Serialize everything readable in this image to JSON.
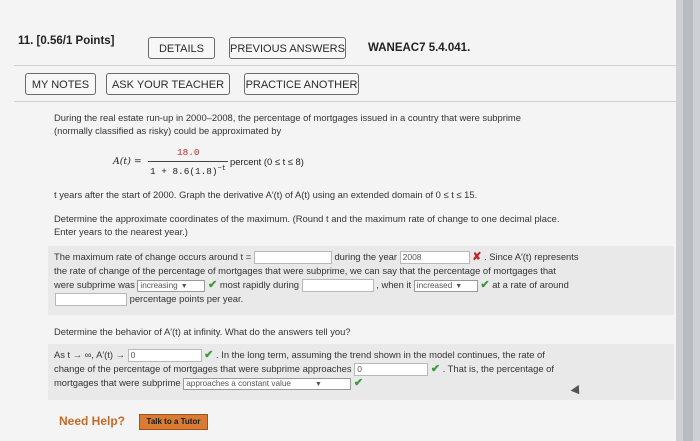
{
  "question": {
    "number_points": "11. [0.56/1 Points]",
    "details": "DETAILS",
    "previous_answers": "PREVIOUS ANSWERS",
    "code": "WANEAC7 5.4.041.",
    "my_notes": "MY NOTES",
    "ask_teacher": "ASK YOUR TEACHER",
    "practice_another": "PRACTICE ANOTHER"
  },
  "text": {
    "intro_1": "During the real estate run-up in 2000–2008, the percentage of mortgages issued in a country that were subprime",
    "intro_2": "(normally classified as risky) could be approximated by",
    "func_name": "A(t) =",
    "numerator": "18.0",
    "denominator": "1 + 8.6(1.8)",
    "exponent": "−t",
    "func_tail": "percent   (0 ≤ t ≤ 8)",
    "line_a": "t years after the start of 2000. Graph the derivative A′(t) of A(t) using an extended domain of 0 ≤ t ≤ 15.",
    "line_b1": "Determine the approximate coordinates of the maximum. (Round t and the maximum rate of change to one decimal place.",
    "line_b2": "Enter years to the nearest year.)",
    "max_1": "The maximum rate of change occurs around t =",
    "max_2": "during the year",
    "max_3": ". Since A′(t) represents",
    "max_4": "the rate of change of the percentage of mortgages that were subprime, we can say that the percentage of mortgages that",
    "max_5": "were subprime was",
    "max_6": "most rapidly during",
    "max_7": ", when it",
    "max_8": "at a rate of around",
    "max_9": "percentage points per year.",
    "behavior_q": "Determine the behavior of A′(t) at infinity. What do the answers tell you?",
    "inf_1": "As t → ∞, A′(t) →",
    "inf_2": ". In the long term, assuming the trend shown in the model continues, the rate of",
    "inf_3": "change of the percentage of mortgages that were subprime approaches",
    "inf_4": ". That is, the percentage of",
    "inf_5": "mortgages that were subprime"
  },
  "answers": {
    "t_max": "",
    "year": "2008",
    "trend_select": "increasing",
    "during": "",
    "it_select": "increased",
    "rate": "",
    "limit": "0",
    "approaches": "0",
    "behavior_select": "approaches a constant value"
  },
  "help": {
    "need_help": "Need Help?",
    "tutor": "Talk to a Tutor"
  },
  "colors": {
    "check": "#3a9a3a",
    "cross": "#c02828",
    "tutor": "#d97b33"
  }
}
